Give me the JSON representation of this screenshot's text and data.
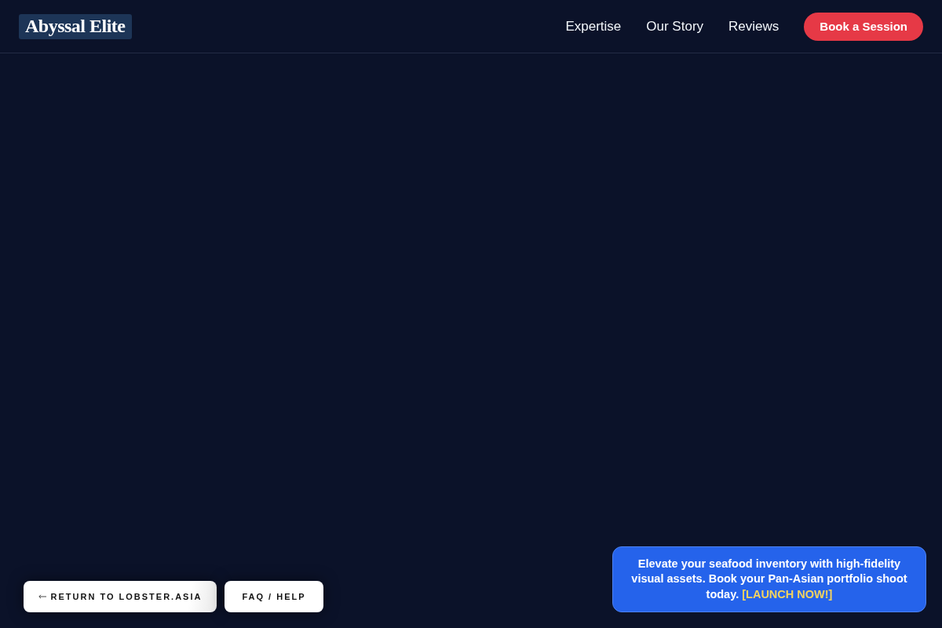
{
  "header": {
    "logo": "Abyssal Elite",
    "nav": [
      {
        "label": "Expertise"
      },
      {
        "label": "Our Story"
      },
      {
        "label": "Reviews"
      }
    ],
    "cta": "Book a Session"
  },
  "footer_buttons": [
    {
      "label": "RETURN TO LOBSTER.ASIA",
      "kind": "back"
    },
    {
      "label": "FAQ / HELP",
      "kind": "plain"
    }
  ],
  "promo_banner": {
    "text": "Elevate your seafood inventory with high-fidelity visual assets. Book your Pan-Asian portfolio shoot today.",
    "link": "[LAUNCH NOW!]"
  }
}
